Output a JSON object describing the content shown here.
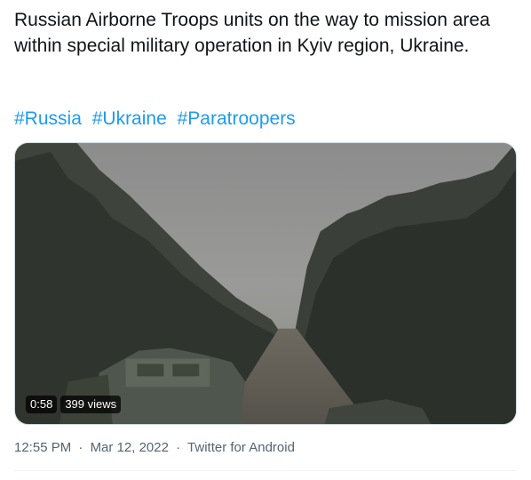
{
  "tweet": {
    "text": "Russian Airborne Troops units on the way to mission area within special military operation in Kyiv region, Ukraine.",
    "hashtags": [
      "#Russia",
      "#Ukraine",
      "#Paratroopers"
    ],
    "media": {
      "duration": "0:58",
      "views": "399 views"
    },
    "meta": {
      "time": "12:55 PM",
      "date": "Mar 12, 2022",
      "source": "Twitter for Android",
      "separator": "·"
    }
  },
  "colors": {
    "link": "#1d9bf0",
    "secondary_text": "#536471",
    "primary_text": "#0f1419",
    "border": "#cfd9de"
  }
}
